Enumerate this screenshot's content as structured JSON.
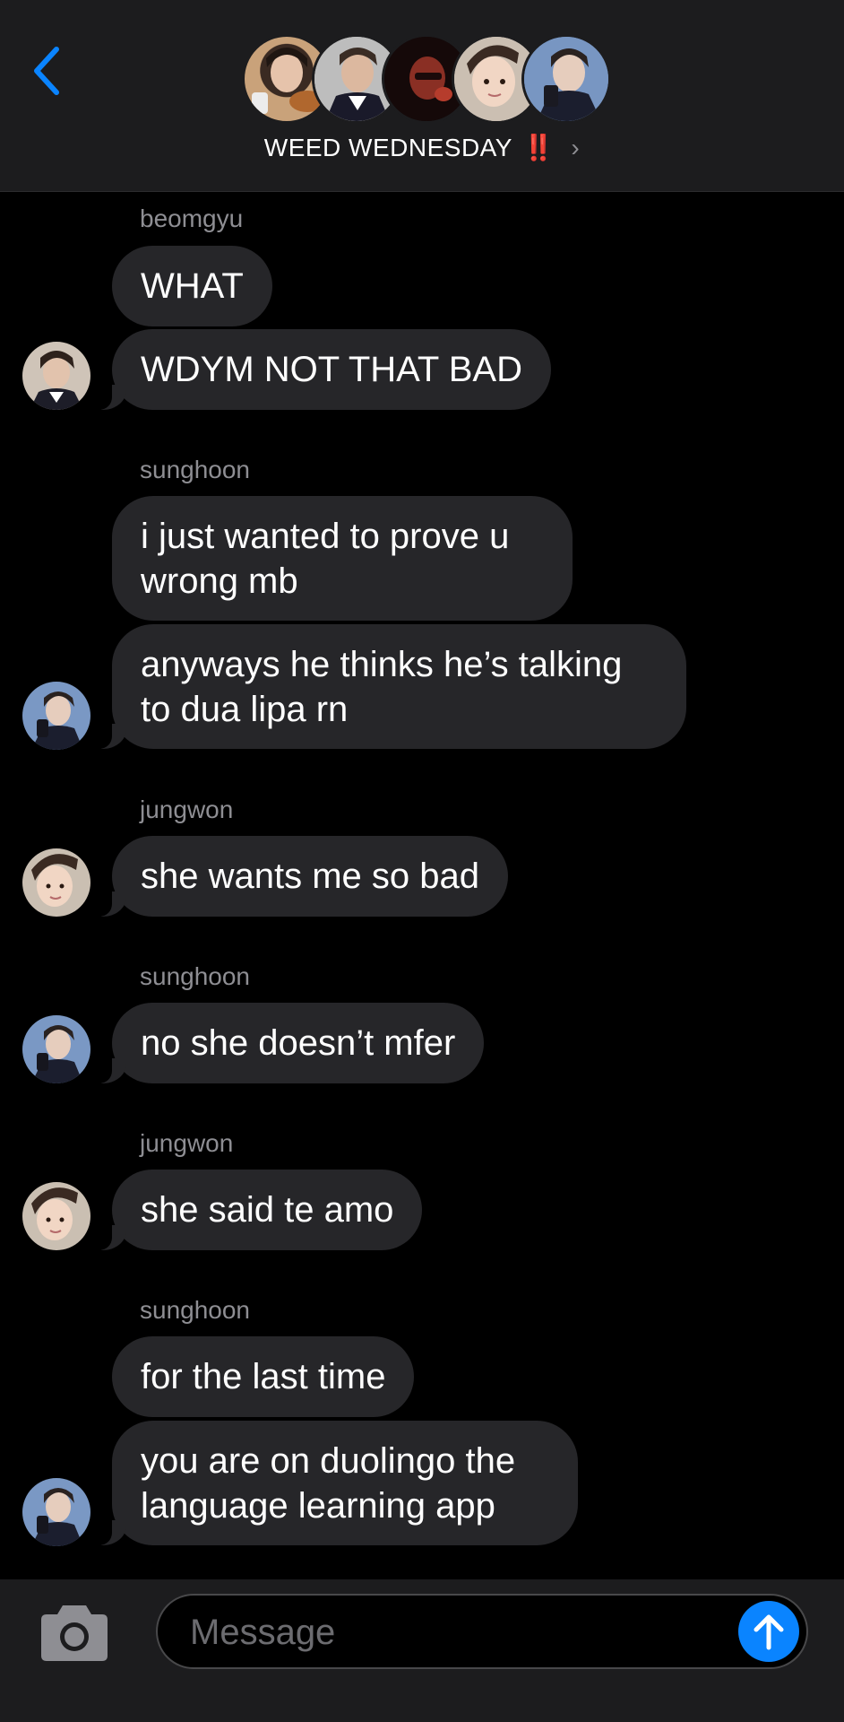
{
  "header": {
    "group_name": "WEED WEDNESDAY",
    "emoji": "‼️",
    "chevron": "›",
    "back_icon": "chevron-left-icon",
    "participants": [
      "beomgyu",
      "member-2",
      "member-3",
      "jungwon",
      "sunghoon"
    ]
  },
  "colors": {
    "header_bg": "#1c1c1e",
    "bubble": "#262629",
    "accent": "#0a84ff",
    "muted_text": "#8e8e93"
  },
  "thread": [
    {
      "sender": "beomgyu",
      "avatar_icon": "beomgyu-avatar",
      "messages": [
        "WHAT",
        "WDYM NOT THAT BAD"
      ]
    },
    {
      "sender": "sunghoon",
      "avatar_icon": "sunghoon-avatar",
      "messages": [
        "i just wanted to prove u wrong mb",
        "anyways he thinks he’s talking to dua lipa rn"
      ]
    },
    {
      "sender": "jungwon",
      "avatar_icon": "jungwon-avatar",
      "messages": [
        "she wants me so bad"
      ]
    },
    {
      "sender": "sunghoon",
      "avatar_icon": "sunghoon-avatar",
      "messages": [
        "no she doesn’t mfer"
      ]
    },
    {
      "sender": "jungwon",
      "avatar_icon": "jungwon-avatar",
      "messages": [
        "she said te amo"
      ]
    },
    {
      "sender": "sunghoon",
      "avatar_icon": "sunghoon-avatar",
      "messages": [
        "for the last time",
        "you are on duolingo the language learning app"
      ]
    }
  ],
  "composer": {
    "placeholder": "Message",
    "value": "",
    "camera_icon": "camera-icon",
    "send_icon": "arrow-up-icon"
  }
}
